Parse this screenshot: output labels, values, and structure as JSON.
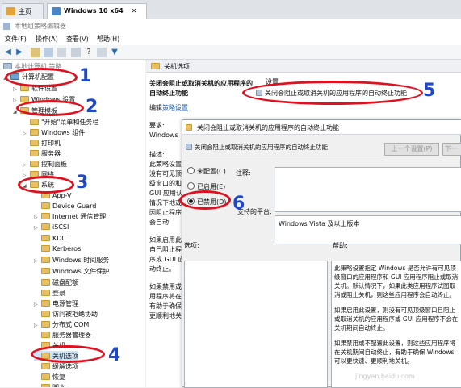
{
  "tabs": [
    {
      "label": "主页"
    },
    {
      "label": "Windows 10 x64"
    }
  ],
  "window_title": "本地组策略编辑器",
  "menu": [
    "文件(F)",
    "操作(A)",
    "查看(V)",
    "帮助(H)"
  ],
  "tree": {
    "root": "本地计算机 策略",
    "items": [
      "计算机配置",
      "软件设置",
      "Windows 设置",
      "管理模板",
      "\"开始\"菜单和任务栏",
      "Windows 组件",
      "打印机",
      "服务器",
      "控制面板",
      "网络",
      "系统",
      "App-V",
      "Device Guard",
      "Internet 通信管理",
      "iSCSI",
      "KDC",
      "Kerberos",
      "Windows 时间服务",
      "Windows 文件保护",
      "磁盘配额",
      "登录",
      "电源管理",
      "访问被拒绝协助",
      "分布式 COM",
      "服务器管理器",
      "关机",
      "关机选项",
      "缓解选项",
      "恢复",
      "脚本"
    ]
  },
  "right": {
    "header": "关机选项",
    "desc_title": "关闭会阻止或取消关机的应用程序的自动终止功能",
    "edit_prefix": "编辑",
    "edit_link": "策略设置",
    "req_label": "要求:",
    "req_value": "Windows",
    "desc_label": "描述:",
    "desc_text": "此策略设置没有可见顶级窗口的和 GUI 应用认情况下地或因阻止程序会自动",
    "desc_text2": "如果启用此自己阻止程序或 GUI 应动终止。",
    "desc_text3": "如果禁用或用程序将在有助于确保更顺利地关",
    "setting_header": "设置",
    "setting_item": "关闭会阻止或取消关机的应用程序的自动终止功能"
  },
  "dialog": {
    "title": "关闭会阻止或取消关机的应用程序的自动终止功能",
    "inner_title": "关闭会阻止或取消关机的应用程序的自动终止功能",
    "prev": "上一个设置(P)",
    "next": "下一",
    "options": [
      {
        "label": "未配置(C)",
        "selected": false
      },
      {
        "label": "已启用(E)",
        "selected": false
      },
      {
        "label": "已禁用(D)",
        "selected": true
      }
    ],
    "comment_label": "注释:",
    "platform_label": "支持的平台:",
    "platform_value": "Windows Vista 及以上版本",
    "options_label": "选项:",
    "help_label": "帮助:",
    "help_text": "此策略设置指定 Windows 是否允许有可见顶级窗口的应用程序和 GUI 应用程序阻止或取消关机。默认情况下，如果此类应用程序试图取消或阻止关机，则这些应用程序会自动终止。",
    "help_text2": "如果启用此设置，则没有可见顶级窗口且阻止或取消关机的应用程序或 GUI 应用程序不会在关机期间自动终止。",
    "help_text3": "如果禁用或不配置此设置，则这些应用程序将在关机期间自动终止，有助于确保 Windows 可以更快速、更顺利地关机。"
  },
  "annotations": [
    "1",
    "2",
    "3",
    "4",
    "5",
    "6"
  ],
  "watermark": "jingyan.baidu.com",
  "colors": {
    "annotation_circle": "#e0101e",
    "annotation_number": "#1e48c8",
    "folder": "#e8c063"
  }
}
